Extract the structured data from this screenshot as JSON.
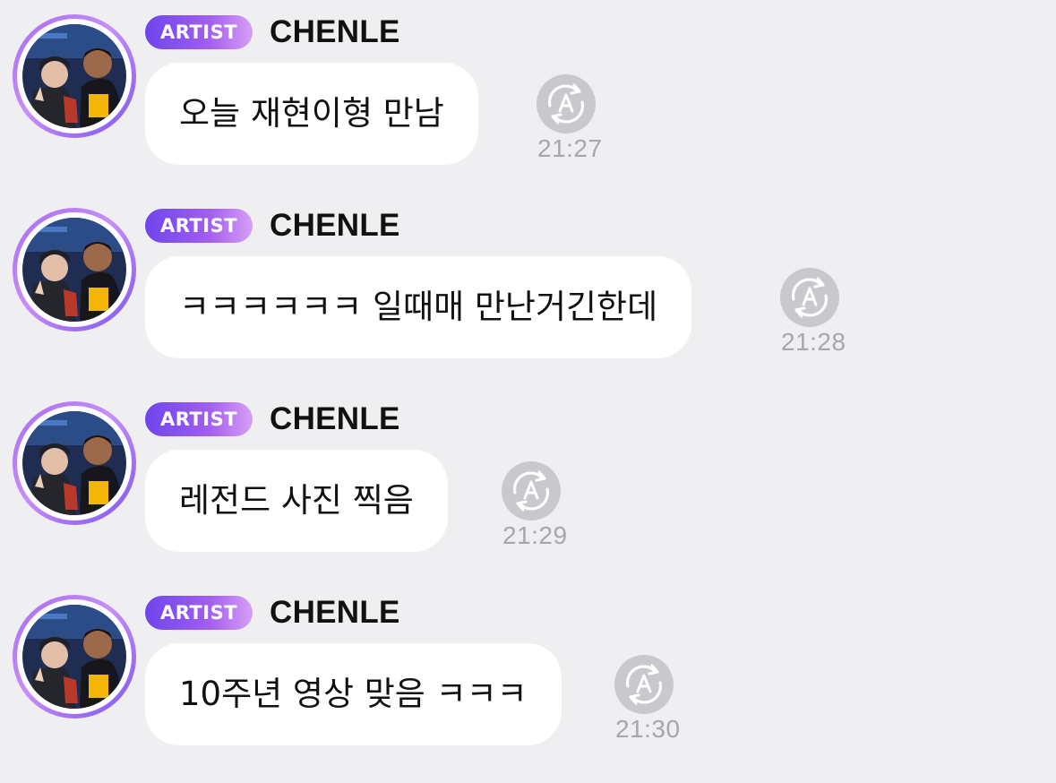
{
  "messages": [
    {
      "badge": "ARTIST",
      "sender": "CHENLE",
      "text": "오늘 재현이형 만남",
      "time": "21:27",
      "icon": "translate-icon"
    },
    {
      "badge": "ARTIST",
      "sender": "CHENLE",
      "text": "ㅋㅋㅋㅋㅋㅋ 일때매 만난거긴한데",
      "time": "21:28",
      "icon": "translate-icon"
    },
    {
      "badge": "ARTIST",
      "sender": "CHENLE",
      "text": "레전드 사진 찍음",
      "time": "21:29",
      "icon": "translate-icon"
    },
    {
      "badge": "ARTIST",
      "sender": "CHENLE",
      "text": "10주년 영상 맞음 ㅋㅋㅋ",
      "time": "21:30",
      "icon": "translate-icon"
    }
  ],
  "colors": {
    "background": "#efeff1",
    "badge_gradient_start": "#6e45ec",
    "badge_gradient_end": "#d89ff6",
    "avatar_ring": "#a66bf5",
    "bubble": "#ffffff",
    "timestamp": "#a7a7ab",
    "translate_icon": "#c9c9cd"
  }
}
